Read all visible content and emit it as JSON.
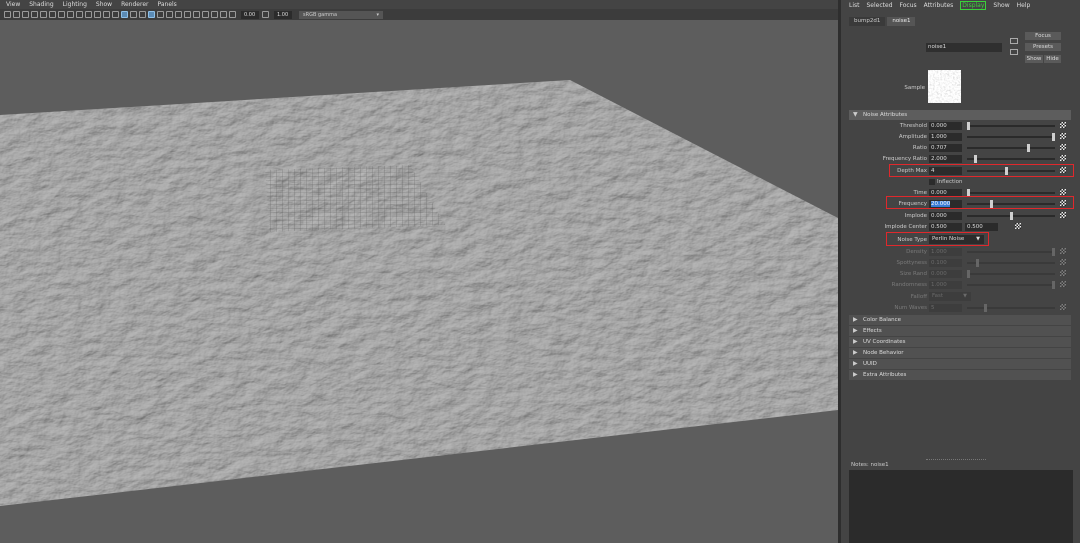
{
  "viewport": {
    "menu": [
      "View",
      "Shading",
      "Lighting",
      "Show",
      "Renderer",
      "Panels"
    ],
    "exposure": "0.00",
    "gamma": "1.00",
    "color_space": "sRGB gamma"
  },
  "ae": {
    "menu": [
      "List",
      "Selected",
      "Focus",
      "Attributes",
      "Display",
      "Show",
      "Help"
    ],
    "menu_selected": "Display",
    "tabs": [
      "bump2d1",
      "noise1"
    ],
    "active_tab": "noise1",
    "node_label": "noise:",
    "node_name": "noise1",
    "buttons": {
      "focus": "Focus",
      "presets": "Presets",
      "show": "Show",
      "hide": "Hide"
    },
    "sample_label": "Sample",
    "section_title": "Noise Attributes",
    "attrs": {
      "threshold": {
        "label": "Threshold",
        "value": "0.000",
        "fill": 0.0
      },
      "amplitude": {
        "label": "Amplitude",
        "value": "1.000",
        "fill": 1.0
      },
      "ratio": {
        "label": "Ratio",
        "value": "0.707",
        "fill": 0.707
      },
      "freq_ratio": {
        "label": "Frequency Ratio",
        "value": "2.000",
        "fill": 0.08
      },
      "depth_max": {
        "label": "Depth Max",
        "value": "4",
        "fill": 0.45
      },
      "inflection": {
        "label": "Inflection"
      },
      "time": {
        "label": "Time",
        "value": "0.000",
        "fill": 0.0
      },
      "frequency": {
        "label": "Frequency",
        "value": "20.000",
        "fill": 0.27
      },
      "implode": {
        "label": "Implode",
        "value": "0.000",
        "fill": 0.5
      },
      "implode_center": {
        "label": "Implode Center",
        "value1": "0.500",
        "value2": "0.500"
      },
      "noise_type": {
        "label": "Noise Type",
        "value": "Perlin Noise"
      },
      "density": {
        "label": "Density",
        "value": "1.000",
        "fill": 1.0
      },
      "spottyness": {
        "label": "Spottyness",
        "value": "0.100",
        "fill": 0.1
      },
      "size_rand": {
        "label": "Size Rand",
        "value": "0.000",
        "fill": 0.0
      },
      "randomness": {
        "label": "Randomness",
        "value": "1.000",
        "fill": 1.0
      },
      "falloff": {
        "label": "Falloff",
        "value": "Fast"
      },
      "num_waves": {
        "label": "Num Waves",
        "value": "5",
        "fill": 0.2
      }
    },
    "sections": [
      "Color Balance",
      "Effects",
      "UV Coordinates",
      "Node Behavior",
      "UUID",
      "Extra Attributes"
    ],
    "notes_label": "Notes:  noise1"
  }
}
